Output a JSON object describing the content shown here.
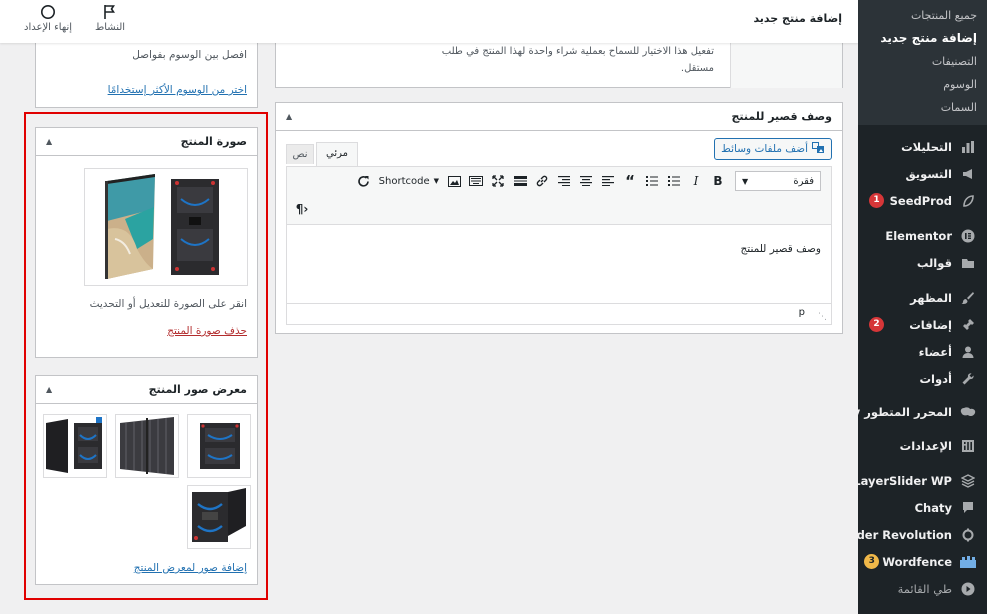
{
  "topbar": {
    "page_title": "إضافة منتج جديد",
    "activity_label": "النشاط",
    "finish_setup_label": "إنهاء الإعداد"
  },
  "sidebar": {
    "submenu": [
      {
        "label": "جميع المنتجات",
        "current": false
      },
      {
        "label": "إضافة منتج جديد",
        "current": true
      },
      {
        "label": "التصنيفات",
        "current": false
      },
      {
        "label": "الوسوم",
        "current": false
      },
      {
        "label": "السمات",
        "current": false
      }
    ],
    "items": [
      {
        "label": "التحليلات",
        "icon": "bar-chart-icon"
      },
      {
        "label": "التسويق",
        "icon": "megaphone-icon"
      },
      {
        "label": "SeedProd",
        "icon": "seedprod-icon",
        "badge": "1"
      },
      {
        "label": "Elementor",
        "icon": "elementor-icon"
      },
      {
        "label": "قوالب",
        "icon": "folder-icon"
      },
      {
        "label": "المظهر",
        "icon": "brush-icon"
      },
      {
        "label": "إضافات",
        "icon": "plugin-icon",
        "badge": "2"
      },
      {
        "label": "أعضاء",
        "icon": "user-icon"
      },
      {
        "label": "أدوات",
        "icon": "wrench-icon"
      },
      {
        "label": "المحرر المتطور WPBakery",
        "icon": "wpbakery-icon"
      },
      {
        "label": "الإعدادات",
        "icon": "settings-icon"
      },
      {
        "label": "LayerSlider WP",
        "icon": "layers-icon"
      },
      {
        "label": "Chaty",
        "icon": "chat-icon"
      },
      {
        "label": "Slider Revolution",
        "icon": "refresh-icon"
      },
      {
        "label": "Wordfence",
        "icon": "wordfence-icon",
        "badge": "3"
      },
      {
        "label": "طي القائمة",
        "icon": "collapse-icon"
      }
    ]
  },
  "excerpt_partial": {
    "text": "تفعيل هذا الاختيار للسماح بعملية شراء واحدة لهذا المنتج في طلب مستقل."
  },
  "tags_box": {
    "hint": "افصل بين الوسوم بفواصل",
    "most_used_link": "اختر من الوسوم الأكثر إستخدامًا"
  },
  "short_description": {
    "title": "وصف قصير للمنتج",
    "add_media": "أضف ملفات وسائط",
    "tab_visual": "مرئي",
    "tab_text": "نص",
    "format_select": "فقرة",
    "shortcode_label": "Shortcode",
    "content": "وصف قصير للمنتج",
    "status_path": "p"
  },
  "product_image": {
    "title": "صورة المنتج",
    "hint": "انقر على الصورة للتعديل أو التحديث",
    "remove_link": "حذف صورة المنتج"
  },
  "gallery": {
    "title": "معرض صور المنتج",
    "add_link": "إضافة صور لمعرض المنتج"
  }
}
